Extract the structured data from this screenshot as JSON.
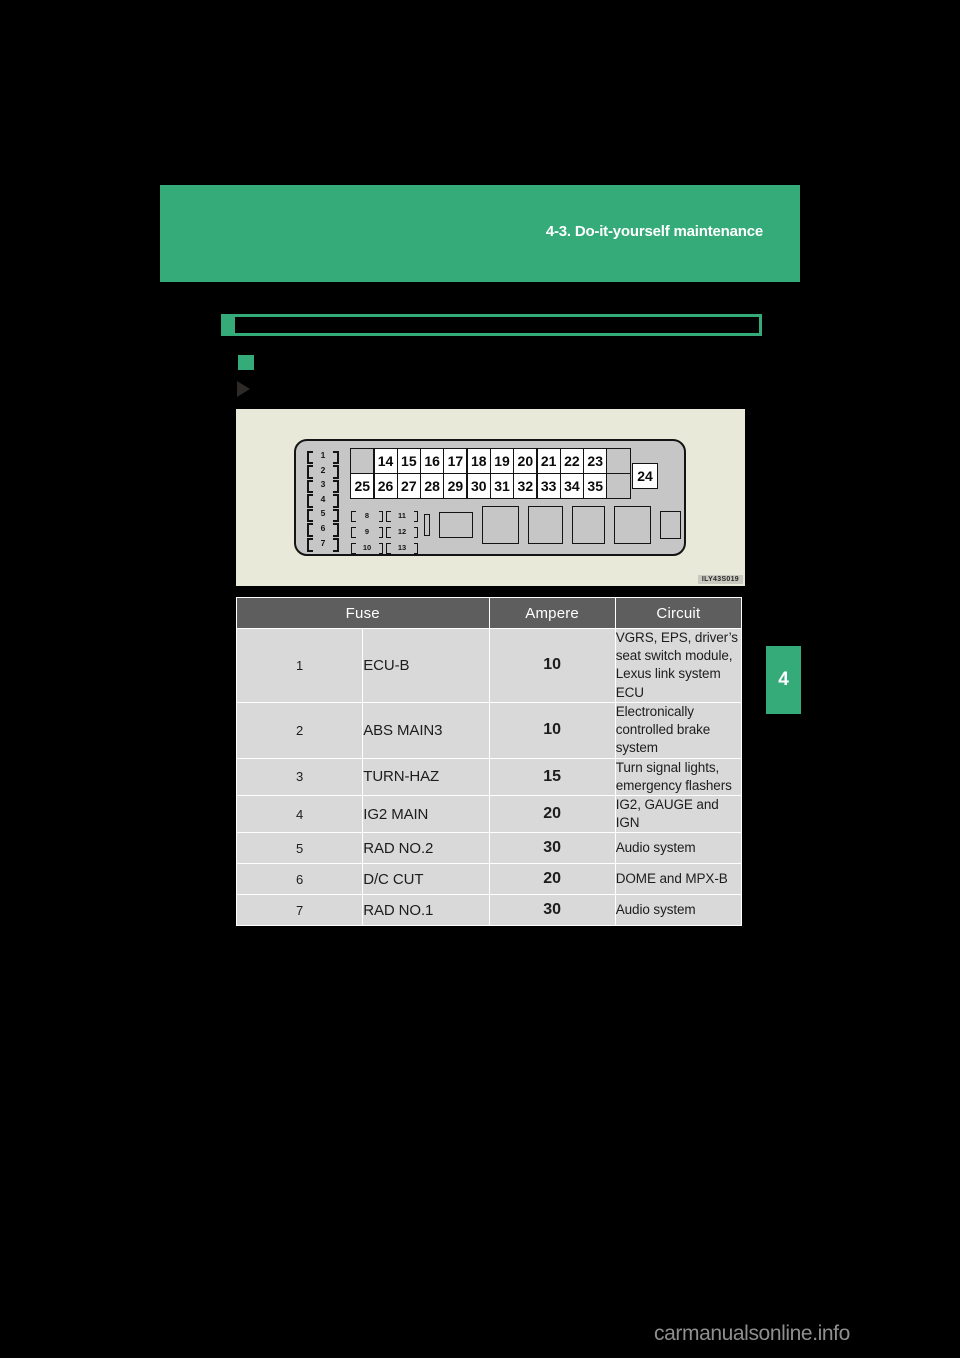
{
  "page": {
    "background_color": "#000000",
    "accent_color": "#34ab79"
  },
  "header": {
    "title": "4-3. Do-it-yourself maintenance"
  },
  "chapter_tab": {
    "number": "4"
  },
  "section": {
    "heading": "",
    "subsection_label": "",
    "detail_label": ""
  },
  "figure": {
    "caption": "ILY43S019",
    "bracket_markers": [
      "1",
      "2",
      "3",
      "4",
      "5",
      "6",
      "7"
    ],
    "small_bracket_markers": [
      "8",
      "11",
      "9",
      "12",
      "10",
      "13"
    ],
    "fuse_grid_row1": [
      "",
      "14",
      "15",
      "16",
      "17",
      "18",
      "19",
      "20",
      "21",
      "22",
      "23",
      ""
    ],
    "fuse_grid_row2": [
      "25",
      "26",
      "27",
      "28",
      "29",
      "30",
      "31",
      "32",
      "33",
      "34",
      "35",
      ""
    ],
    "offset_fuse": "24",
    "relay_blocks": [
      "r0",
      "r1",
      "r2",
      "r3",
      "r4",
      "r5",
      "r6"
    ]
  },
  "table": {
    "columns": [
      "Fuse",
      "Ampere",
      "Circuit"
    ],
    "rows": [
      {
        "no": "1",
        "name": "ECU-B",
        "ampere": "10",
        "circuit": "VGRS, EPS, driver’s seat switch module, Lexus link system ECU",
        "height": "tall"
      },
      {
        "no": "2",
        "name": "ABS MAIN3",
        "ampere": "10",
        "circuit": "Electronically controlled brake system",
        "height": "tall"
      },
      {
        "no": "3",
        "name": "TURN-HAZ",
        "ampere": "15",
        "circuit": "Turn signal lights, emergency flashers",
        "height": "short"
      },
      {
        "no": "4",
        "name": "IG2 MAIN",
        "ampere": "20",
        "circuit": "IG2, GAUGE and IGN",
        "height": "short"
      },
      {
        "no": "5",
        "name": "RAD NO.2",
        "ampere": "30",
        "circuit": "Audio system",
        "height": "short"
      },
      {
        "no": "6",
        "name": "D/C CUT",
        "ampere": "20",
        "circuit": "DOME and MPX-B",
        "height": "short"
      },
      {
        "no": "7",
        "name": "RAD NO.1",
        "ampere": "30",
        "circuit": "Audio system",
        "height": "short"
      }
    ]
  },
  "watermark": {
    "text": "carmanualsonline.info"
  }
}
